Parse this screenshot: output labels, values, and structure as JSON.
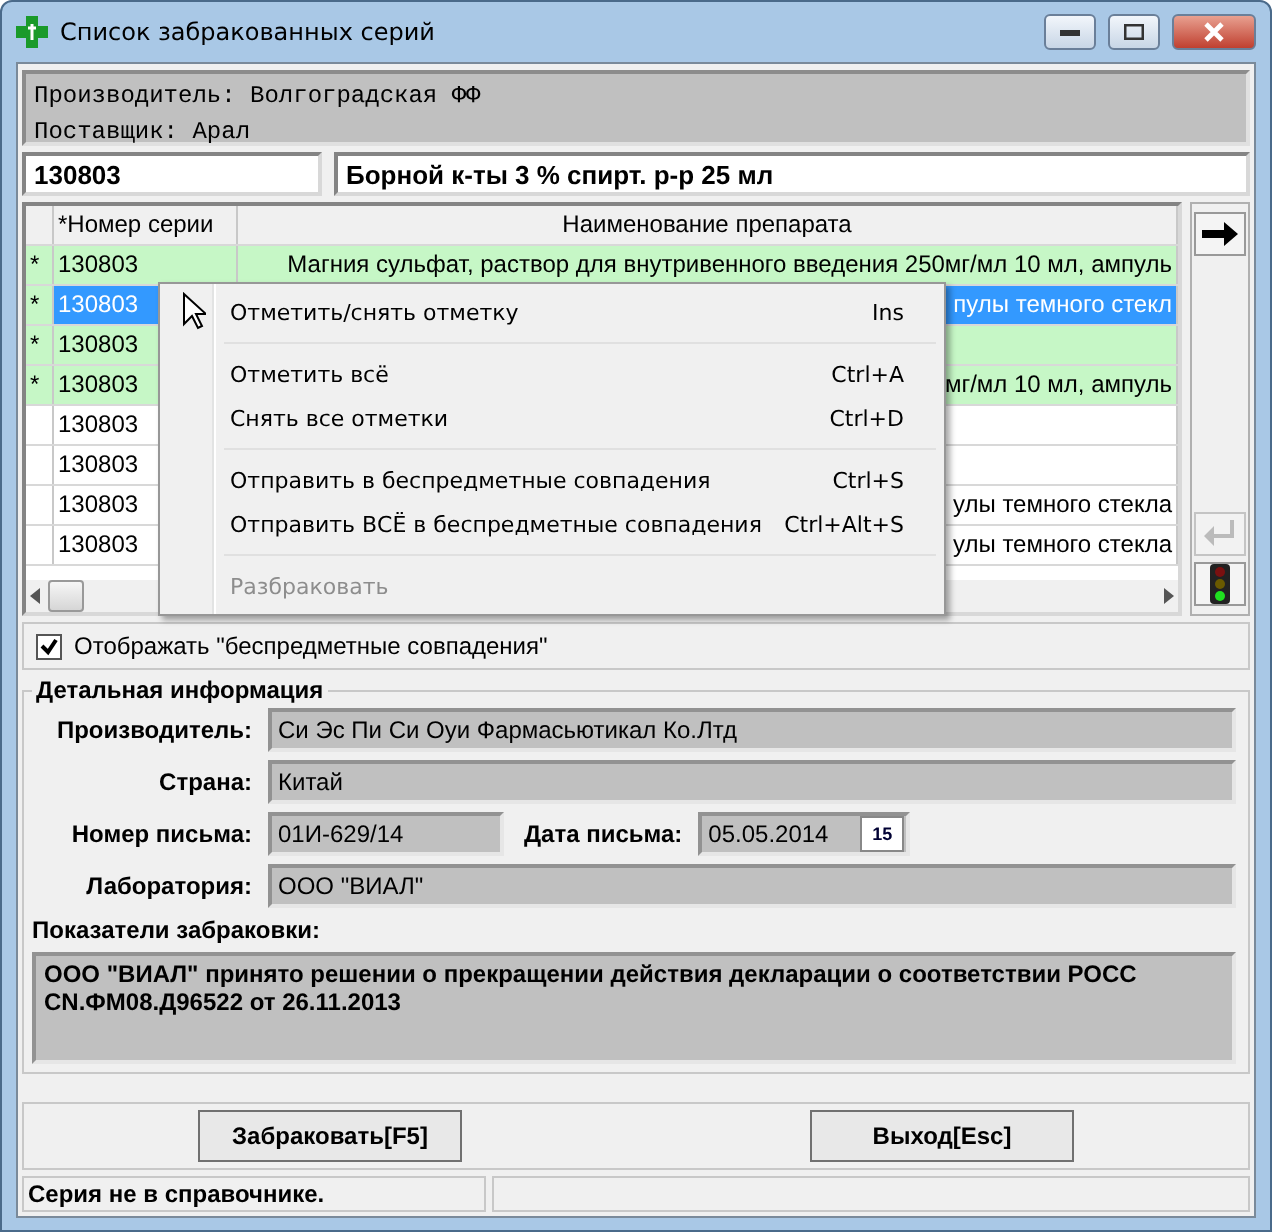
{
  "window": {
    "title": "Список забракованных серий"
  },
  "info": [
    "Производитель: Волгоградская ФФ",
    "Поставщик: Арал"
  ],
  "search": {
    "series": "130803",
    "product": "Борной к-ты 3 % спирт. р-р 25 мл"
  },
  "table": {
    "columns": [
      "*Номер серии",
      "Наименование препарата"
    ],
    "rows": [
      {
        "marker": "*",
        "series": "130803",
        "name": "Магния сульфат, раствор для внутривенного введения 250мг/мл 10 мл, ампуль",
        "marked": true,
        "selected": false
      },
      {
        "marker": "*",
        "series": "130803",
        "name": "пулы темного стекл",
        "marked": true,
        "selected": true
      },
      {
        "marker": "*",
        "series": "130803",
        "name": "",
        "marked": true,
        "selected": false
      },
      {
        "marker": "*",
        "series": "130803",
        "name": "мг/мл 10 мл, ампуль",
        "marked": true,
        "selected": false
      },
      {
        "marker": "",
        "series": "130803",
        "name": "",
        "marked": false,
        "selected": false
      },
      {
        "marker": "",
        "series": "130803",
        "name": "",
        "marked": false,
        "selected": false
      },
      {
        "marker": "",
        "series": "130803",
        "name": "улы темного стекла",
        "marked": false,
        "selected": false
      },
      {
        "marker": "",
        "series": "130803",
        "name": "улы темного стекла",
        "marked": false,
        "selected": false
      }
    ]
  },
  "side_buttons": [
    {
      "kind": "arrow",
      "disabled": false
    },
    {
      "kind": "return",
      "disabled": true
    },
    {
      "kind": "light",
      "disabled": false
    }
  ],
  "context_menu": [
    {
      "kind": "item",
      "label": "Отметить/снять отметку",
      "shortcut": "Ins",
      "disabled": false
    },
    {
      "kind": "separator"
    },
    {
      "kind": "item",
      "label": "Отметить всё",
      "shortcut": "Ctrl+A",
      "disabled": false
    },
    {
      "kind": "item",
      "label": "Снять все отметки",
      "shortcut": "Ctrl+D",
      "disabled": false
    },
    {
      "kind": "separator"
    },
    {
      "kind": "item",
      "label": "Отправить в беспредметные совпадения",
      "shortcut": "Ctrl+S",
      "disabled": false
    },
    {
      "kind": "item",
      "label": "Отправить ВСЁ в беспредметные совпадения",
      "shortcut": "Ctrl+Alt+S",
      "disabled": false
    },
    {
      "kind": "separator"
    },
    {
      "kind": "item",
      "label": "Разбраковать",
      "disabled": true
    }
  ],
  "show_matches": {
    "label": "Отображать \"беспредметные совпадения\"",
    "checked": true
  },
  "details": {
    "title": "Детальная информация",
    "manufacturer": {
      "label": "Производитель:",
      "value": "Си Эс Пи Си Оуи Фармасьютикал Ко.Лтд"
    },
    "country": {
      "label": "Страна:",
      "value": "Китай"
    },
    "letter_number": {
      "label": "Номер письма:",
      "value": "01И-629/14"
    },
    "letter_date": {
      "label": "Дата письма:",
      "value": "05.05.2014",
      "calendar": "15"
    },
    "laboratory": {
      "label": "Лаборатория:",
      "value": "ООО \"ВИАЛ\""
    }
  },
  "reasons": {
    "label": "Показатели забраковки:",
    "text": "ООО \"ВИАЛ\" принято решении о прекращении действия декларации о соответствии РОСС CN.ФМ08.Д96522 от 26.11.2013"
  },
  "buttons": [
    "Забраковать[F5]",
    "Выход[Esc]"
  ],
  "status_bar": {
    "message": "Серия не в справочнике."
  }
}
